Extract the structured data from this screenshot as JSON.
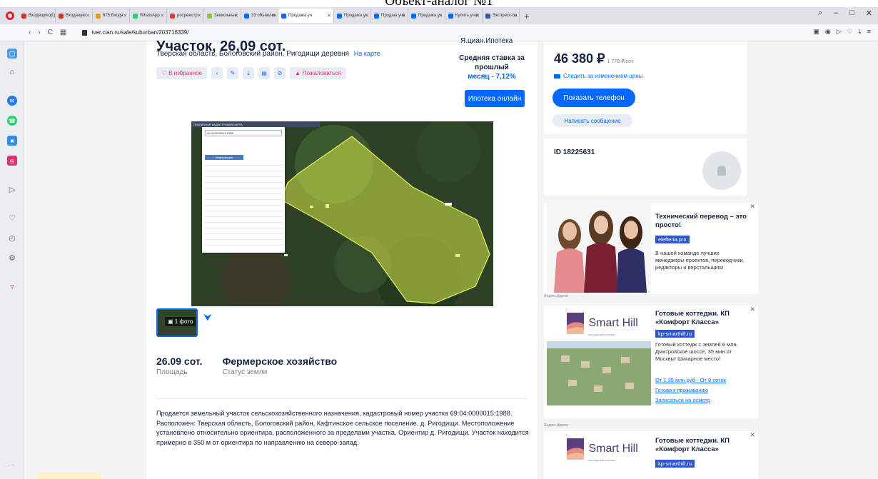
{
  "document_title": "Объект-аналог №1",
  "browser": {
    "tabs": [
      {
        "label": "Входящие (1)",
        "color": "#d93025",
        "active": false
      },
      {
        "label": "Входящие",
        "color": "#d93025",
        "active": false
      },
      {
        "label": "675 Входя",
        "color": "#e8a000",
        "active": false
      },
      {
        "label": "WhatsApp",
        "color": "#25d366",
        "active": false
      },
      {
        "label": "росреестр",
        "color": "#e53935",
        "active": false
      },
      {
        "label": "Земельные",
        "color": "#8bc34a",
        "active": false
      },
      {
        "label": "33 объявлен",
        "color": "#0468ff",
        "active": false
      },
      {
        "label": "Продажа уч",
        "color": "#0468ff",
        "active": true
      },
      {
        "label": "Продажа уч",
        "color": "#0468ff",
        "active": false
      },
      {
        "label": "Продаю уча",
        "color": "#0468ff",
        "active": false
      },
      {
        "label": "Продажа уч",
        "color": "#0468ff",
        "active": false
      },
      {
        "label": "Купить учас",
        "color": "#0468ff",
        "active": false
      },
      {
        "label": "Экспресс-па",
        "color": "#3b5998",
        "active": false
      }
    ],
    "url": "tver.cian.ru/sale/suburban/203716339/"
  },
  "listing": {
    "title": "Участок, 26,09 сот.",
    "address": "Тверская область, Бологовский район, Ригодищи деревня",
    "map_link": "На карте",
    "favorite_label": "В избранное",
    "complain_label": "Пожаловаться",
    "ipoteka_label": "Я.циан.Ипотека",
    "rate_title": "Средняя ставка за прошлый",
    "rate_value": "месяц - 7,12%",
    "ipoteka_button": "Ипотека онлайн",
    "photo_badge": "1 фото",
    "cadastral_header": "ПУБЛИЧНАЯ КАДАСТРОВАЯ КАРТА",
    "cadastral_search": "69:04:0000015:1988",
    "cadastral_tab": "Информация",
    "area_value": "26.09 сот.",
    "area_label": "Площадь",
    "land_status_value": "Фермерское хозяйство",
    "land_status_label": "Статус земли",
    "description": "Продается земельный участок сельскохозяйственного назначения, кадастровый номер участка 69:04:0000015:1988. Расположен: Тверская область, Бологовский район, Кафтинское сельское поселение, д. Ригодищи. Местоположение установлено относительно ориентира, расположенного за пределами участка. Ориентир д. Ригодищи. Участок находится примерно в 350 м от ориентира по направлению на северо-запад."
  },
  "contact": {
    "price": "46 380 ₽",
    "price_per": "1 778 ₽/сот.",
    "follow_price": "Следить за изменением цены",
    "phone_button": "Показать телефон",
    "message_button": "Написать сообщение",
    "id_text": "ID 18225631"
  },
  "ads": [
    {
      "title": "Технический перевод – это просто!",
      "domain": "elefteria.pro",
      "text": "В нашей команде лучшие менеджеры проектов, переводчики, редакторы и верстальщики",
      "source": "Яндекс.Директ"
    },
    {
      "title": "Готовые коттеджи. КП «Комфорт Класса»",
      "domain": "kp-smarthill.ru",
      "text": "Готовый коттедж с землей 6 млн. Дмитровское шоссе, 35 мин от Москвы! Шикарное место!",
      "link1": "От 1,35 млн руб · От 8 соток",
      "link2": "Готово к проживанию",
      "link3": "Записаться на осмотр",
      "brand": "Smart Hill",
      "brand_sub": "коттеджный поселок",
      "source": "Яндекс.Директ"
    },
    {
      "title": "Готовые коттеджи. КП «Комфорт Класса»",
      "domain": "kp-smarthill.ru",
      "brand": "Smart Hill",
      "brand_sub": "коттеджный поселок"
    }
  ],
  "colors": {
    "accent": "#0468ff",
    "danger": "#e8325b",
    "polygon": "#d6e84a"
  }
}
